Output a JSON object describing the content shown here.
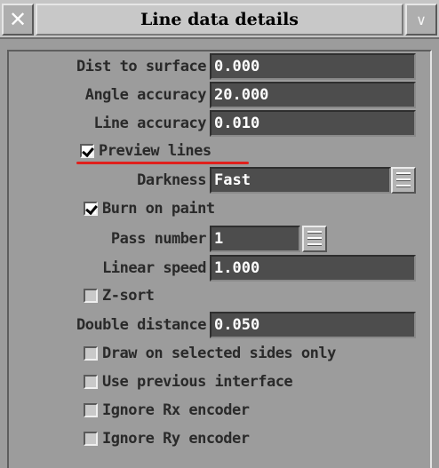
{
  "window": {
    "title": "Line data details",
    "close_glyph": "✕",
    "collapse_glyph": "∨"
  },
  "fields": {
    "dist_to_surface": {
      "label": "Dist to surface",
      "value": "0.000"
    },
    "angle_accuracy": {
      "label": "Angle accuracy",
      "value": "20.000"
    },
    "line_accuracy": {
      "label": "Line accuracy",
      "value": "0.010"
    },
    "darkness": {
      "label": "Darkness",
      "value": "Fast"
    },
    "pass_number": {
      "label": "Pass number",
      "value": "1"
    },
    "linear_speed": {
      "label": "Linear speed",
      "value": "1.000"
    },
    "double_distance": {
      "label": "Double distance",
      "value": "0.050"
    }
  },
  "checkboxes": {
    "preview_lines": {
      "label": "Preview lines",
      "checked": true
    },
    "burn_on_paint": {
      "label": "Burn on paint",
      "checked": true
    },
    "z_sort": {
      "label": "Z-sort",
      "checked": false
    },
    "draw_selected_sides": {
      "label": "Draw on selected sides only",
      "checked": false
    },
    "use_previous_interface": {
      "label": "Use previous interface",
      "checked": false
    },
    "ignore_rx_encoder": {
      "label": "Ignore Rx encoder",
      "checked": false
    },
    "ignore_ry_encoder": {
      "label": "Ignore Ry encoder",
      "checked": false
    }
  },
  "annotation": {
    "underline_color": "#e0201c"
  }
}
